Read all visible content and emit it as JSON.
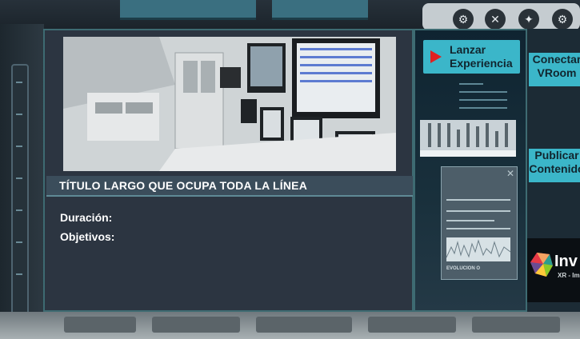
{
  "main": {
    "title": "TÍTULO LARGO QUE OCUPA TODA LA LÍNEA",
    "duration_label": "Duración:",
    "objectives_label": "Objetivos:",
    "image_alt": "Control room simulation"
  },
  "side": {
    "launch_line1": "Lanzar",
    "launch_line2": "Experiencia",
    "doc_footer": "EVOLUCION O"
  },
  "right": {
    "connect_line1": "Conectar",
    "connect_line2": "VRoom",
    "publish_line1": "Publicar",
    "publish_line2": "Contenido",
    "logo_text": "Inv",
    "logo_sub": "XR - Im"
  },
  "colors": {
    "accent": "#3bb6c9",
    "panel": "#2c3541",
    "border": "#3e6b72",
    "play": "#e02020"
  },
  "icons": [
    "settings-icon",
    "close-icon",
    "gear-icon",
    "play-icon"
  ]
}
